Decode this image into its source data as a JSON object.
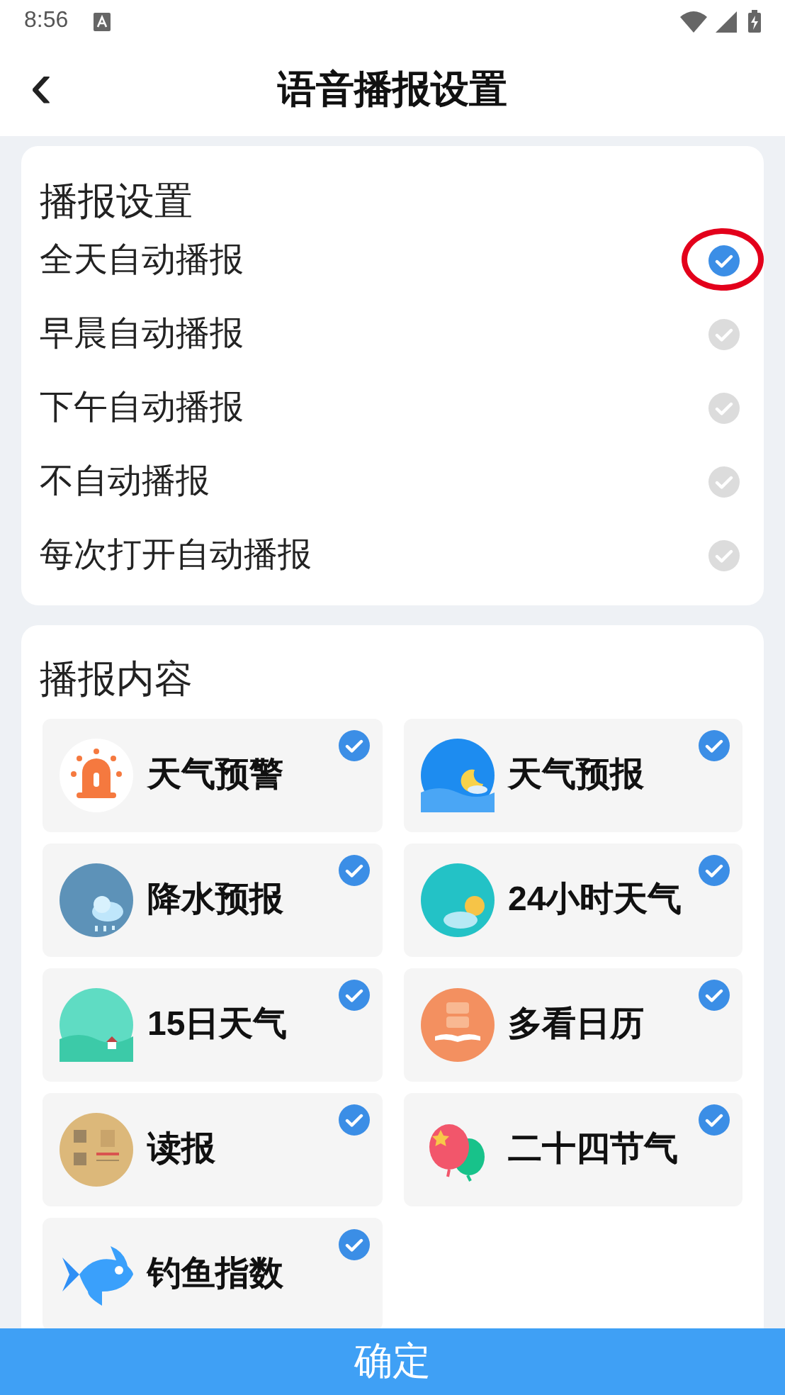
{
  "status_bar": {
    "time": "8:56"
  },
  "header": {
    "back": "‹",
    "title": "语音播报设置"
  },
  "broadcast_settings": {
    "title": "播报设置",
    "options": [
      {
        "label": "全天自动播报",
        "selected": true,
        "annotated": true
      },
      {
        "label": "早晨自动播报",
        "selected": false,
        "annotated": false
      },
      {
        "label": "下午自动播报",
        "selected": false,
        "annotated": false
      },
      {
        "label": "不自动播报",
        "selected": false,
        "annotated": false
      },
      {
        "label": "每次打开自动播报",
        "selected": false,
        "annotated": false
      }
    ]
  },
  "broadcast_content": {
    "title": "播报内容",
    "items": [
      {
        "label": "天气预警",
        "checked": true
      },
      {
        "label": "天气预报",
        "checked": true
      },
      {
        "label": "降水预报",
        "checked": true
      },
      {
        "label": "24小时天气",
        "checked": true
      },
      {
        "label": "15日天气",
        "checked": true
      },
      {
        "label": "多看日历",
        "checked": true
      },
      {
        "label": "读报",
        "checked": true
      },
      {
        "label": "二十四节气",
        "checked": true
      },
      {
        "label": "钓鱼指数",
        "checked": true
      }
    ]
  },
  "confirm_button": "确定"
}
